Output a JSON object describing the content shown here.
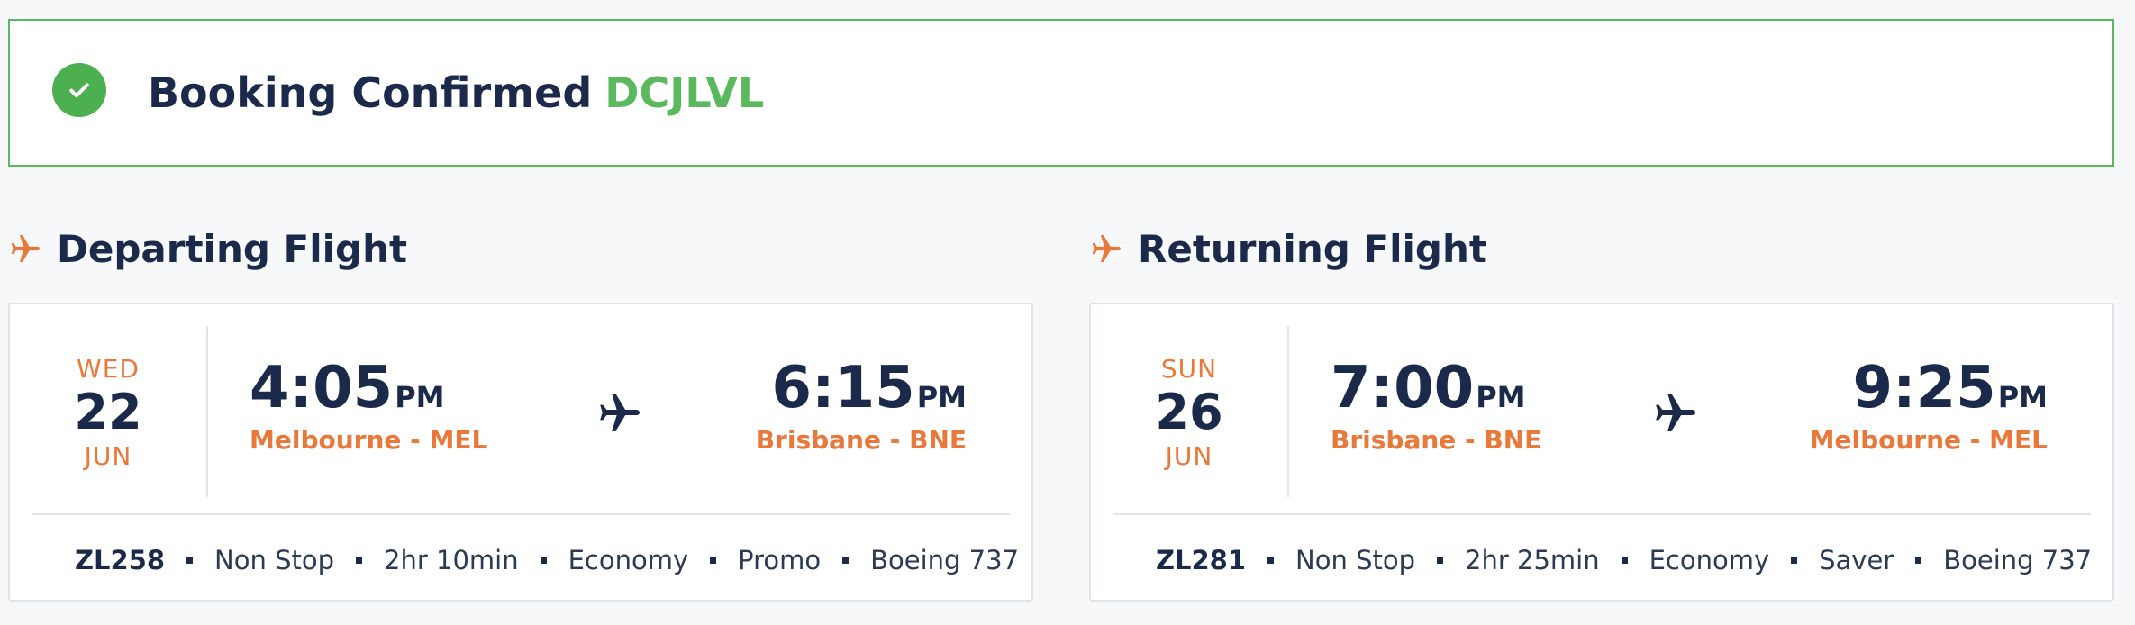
{
  "banner": {
    "title": "Booking Confirmed",
    "reference": "DCJLVL",
    "color": "#5cb85c"
  },
  "departing": {
    "heading": "Departing Flight",
    "date": {
      "dow": "WED",
      "day": "22",
      "month": "JUN"
    },
    "depart": {
      "time": "4:05",
      "ampm": "PM",
      "city": "Melbourne - MEL"
    },
    "arrive": {
      "time": "6:15",
      "ampm": "PM",
      "city": "Brisbane - BNE"
    },
    "details": {
      "flight_no": "ZL258",
      "stops": "Non Stop",
      "duration": "2hr 10min",
      "cabin": "Economy",
      "fare": "Promo",
      "aircraft": "Boeing 737"
    }
  },
  "returning": {
    "heading": "Returning Flight",
    "date": {
      "dow": "SUN",
      "day": "26",
      "month": "JUN"
    },
    "depart": {
      "time": "7:00",
      "ampm": "PM",
      "city": "Brisbane - BNE"
    },
    "arrive": {
      "time": "9:25",
      "ampm": "PM",
      "city": "Melbourne - MEL"
    },
    "details": {
      "flight_no": "ZL281",
      "stops": "Non Stop",
      "duration": "2hr 25min",
      "cabin": "Economy",
      "fare": "Saver",
      "aircraft": "Boeing 737"
    }
  },
  "icons": {
    "check": "check-circle-icon",
    "section_plane": "airplane-icon",
    "route_plane": "airplane-icon"
  },
  "colors": {
    "accent": "#e8793a",
    "navy": "#1b2a4a",
    "success": "#4caf50"
  }
}
